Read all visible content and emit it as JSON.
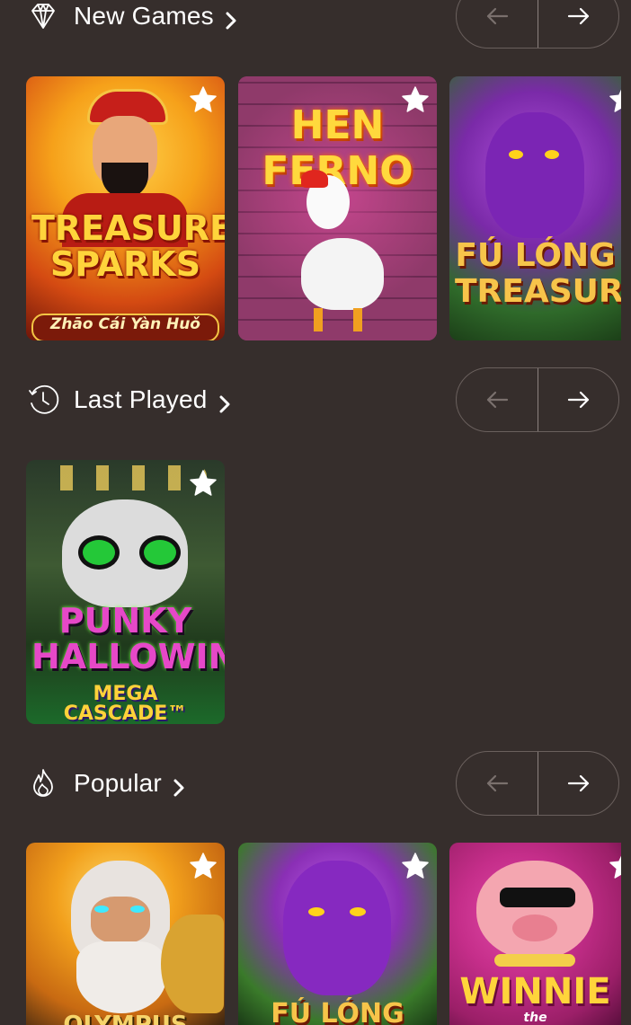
{
  "sections": [
    {
      "title": "New Games",
      "icon": "diamond-icon",
      "games": [
        {
          "title": "TREASURE SPARKS",
          "subtitle": "Zhāo Cái Yàn Huǒ",
          "art": "god-of-wealth",
          "colors": [
            "#f6a11a",
            "#d44a12",
            "#6e1509"
          ]
        },
        {
          "title": "HEN FERNO",
          "subtitle": "",
          "art": "rooster",
          "colors": [
            "#b0487e",
            "#7c2f5b",
            "#3c2a2e"
          ]
        },
        {
          "title": "FÚ LÓNG TREASURE",
          "subtitle": "",
          "art": "purple-dragon",
          "colors": [
            "#7a2aa8",
            "#2f6a2a",
            "#1c3f18"
          ]
        }
      ]
    },
    {
      "title": "Last Played",
      "icon": "history-clock-icon",
      "games": [
        {
          "title": "PUNKY HALLOWIN",
          "subtitle": "MEGA CASCADE™",
          "art": "skull",
          "colors": [
            "#3e5a33",
            "#253820",
            "#1c6a2a"
          ]
        }
      ]
    },
    {
      "title": "Popular",
      "icon": "flame-icon",
      "games": [
        {
          "title": "OLYMPUS",
          "subtitle": "",
          "art": "zeus",
          "colors": [
            "#f2a01c",
            "#c86a12",
            "#3b2410"
          ]
        },
        {
          "title": "FÚ LÓNG",
          "subtitle": "",
          "art": "purple-dragon",
          "colors": [
            "#8a2fb5",
            "#3a7a2a",
            "#1a3a16"
          ]
        },
        {
          "title": "WINNIE",
          "subtitle": "the",
          "art": "pig",
          "colors": [
            "#c52e8a",
            "#9b1f68",
            "#5a0f3d"
          ]
        }
      ]
    }
  ],
  "colors": {
    "background": "#362e2c",
    "nav_border": "#6a605d",
    "arrow_disabled": "#7a706d",
    "arrow_enabled": "#ffffff"
  }
}
